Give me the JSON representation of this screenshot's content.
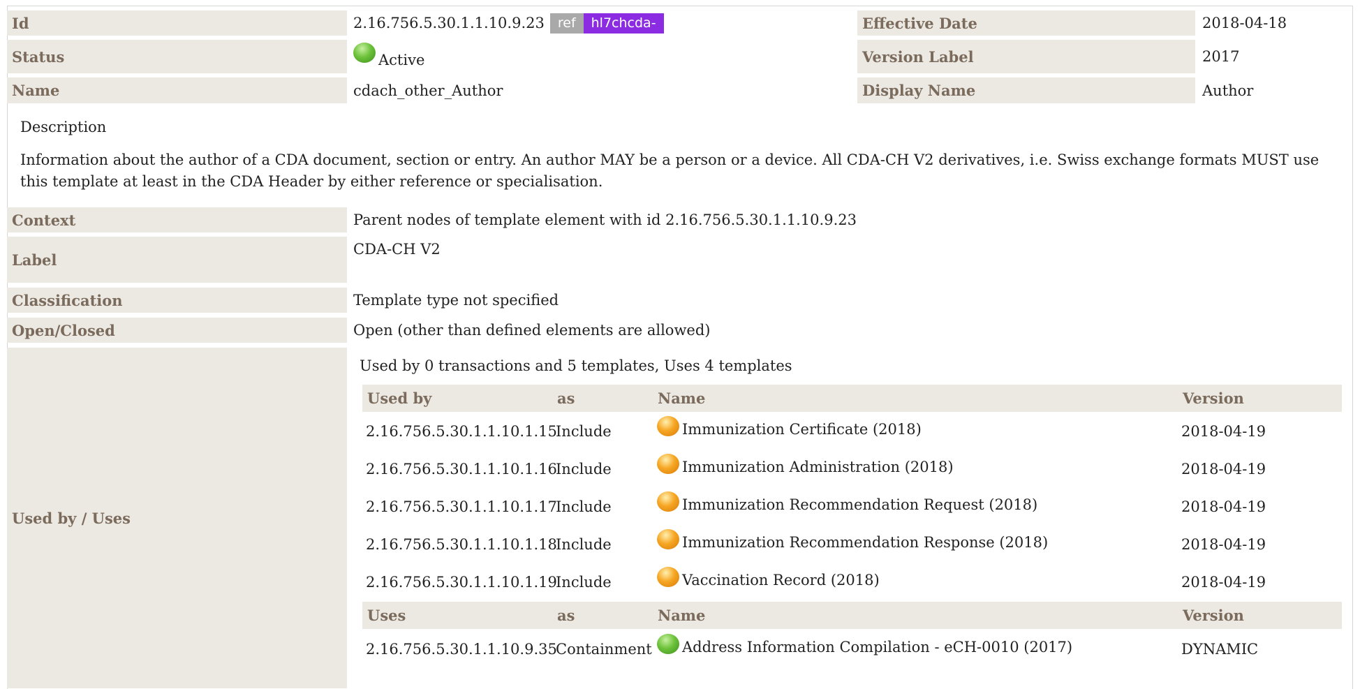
{
  "header": {
    "id_label": "Id",
    "id_value": "2.16.756.5.30.1.1.10.9.23",
    "ref_badge": "ref",
    "prefix_badge": "hl7chcda-",
    "effective_date_label": "Effective Date",
    "effective_date_value": "2018-04-18",
    "status_label": "Status",
    "status_value": "Active",
    "version_label_label": "Version Label",
    "version_label_value": "2017",
    "name_label": "Name",
    "name_value": "cdach_other_Author",
    "display_name_label": "Display Name",
    "display_name_value": "Author"
  },
  "description": {
    "title": "Description",
    "text": "Information about the author of a CDA document, section or entry. An author MAY be a person or a device. All CDA-CH V2 derivatives, i.e. Swiss exchange formats MUST use this template at least in the CDA Header by either reference or specialisation."
  },
  "props": {
    "context_label": "Context",
    "context_value": "Parent nodes of template element with id 2.16.756.5.30.1.1.10.9.23",
    "label_label": "Label",
    "label_value": "CDA-CH V2",
    "classification_label": "Classification",
    "classification_value": "Template type not specified",
    "open_closed_label": "Open/Closed",
    "open_closed_value": "Open (other than defined elements are allowed)",
    "used_by_uses_label": "Used by / Uses"
  },
  "usage": {
    "summary": "Used by 0 transactions and 5 templates, Uses 4 templates",
    "used_by_headers": [
      "Used by",
      "as",
      "Name",
      "Version"
    ],
    "used_by_rows": [
      {
        "id": "2.16.756.5.30.1.1.10.1.15",
        "as": "Include",
        "name": "Immunization Certificate (2018)",
        "version": "2018-04-19",
        "status_color": "orange"
      },
      {
        "id": "2.16.756.5.30.1.1.10.1.16",
        "as": "Include",
        "name": "Immunization Administration (2018)",
        "version": "2018-04-19",
        "status_color": "orange"
      },
      {
        "id": "2.16.756.5.30.1.1.10.1.17",
        "as": "Include",
        "name": "Immunization Recommendation Request (2018)",
        "version": "2018-04-19",
        "status_color": "orange"
      },
      {
        "id": "2.16.756.5.30.1.1.10.1.18",
        "as": "Include",
        "name": "Immunization Recommendation Response (2018)",
        "version": "2018-04-19",
        "status_color": "orange"
      },
      {
        "id": "2.16.756.5.30.1.1.10.1.19",
        "as": "Include",
        "name": "Vaccination Record (2018)",
        "version": "2018-04-19",
        "status_color": "orange"
      }
    ],
    "uses_headers": [
      "Uses",
      "as",
      "Name",
      "Version"
    ],
    "uses_rows": [
      {
        "id": "2.16.756.5.30.1.1.10.9.35",
        "as": "Containment",
        "name": "Address Information Compilation - eCH-0010 (2017)",
        "version": "DYNAMIC",
        "status_color": "green"
      }
    ]
  },
  "colors": {
    "label_bg": "#ece8e2",
    "label_text": "#7a6b5c",
    "ref_badge_bg": "#a9a9a9",
    "prefix_badge_bg": "#8b2be2"
  }
}
